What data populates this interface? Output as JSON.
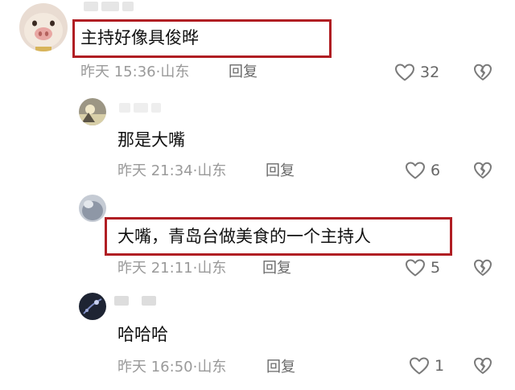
{
  "comments": [
    {
      "text": "主持好像具俊晔",
      "time": "昨天 15:36",
      "location": "山东",
      "reply_label": "回复",
      "likes": "32",
      "highlighted": true
    },
    {
      "text": "那是大嘴",
      "time": "昨天 21:34",
      "location": "山东",
      "reply_label": "回复",
      "likes": "6",
      "highlighted": false
    },
    {
      "text": "大嘴，青岛台做美食的一个主持人",
      "time": "昨天 21:11",
      "location": "山东",
      "reply_label": "回复",
      "likes": "5",
      "highlighted": true
    },
    {
      "text": "哈哈哈",
      "time": "昨天 16:50",
      "location": "山东",
      "reply_label": "回复",
      "likes": "1",
      "highlighted": false
    }
  ],
  "separator": "·",
  "icons": {
    "like": "heart-outline-icon",
    "dislike": "broken-heart-icon"
  },
  "colors": {
    "highlight_border": "#b01e23",
    "meta_text": "#9a9a9a",
    "icon_gray": "#7a7a7a"
  }
}
